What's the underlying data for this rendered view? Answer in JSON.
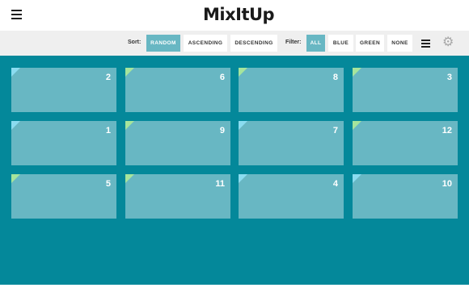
{
  "header": {
    "logo_text": "MixItUp",
    "menu_icon": "hamburger-menu-icon"
  },
  "controls": {
    "sort_label": "Sort:",
    "sort_options": [
      "RANDOM",
      "ASCENDING",
      "DESCENDING"
    ],
    "sort_selected": "RANDOM",
    "filter_label": "Filter:",
    "filter_options": [
      "ALL",
      "BLUE",
      "GREEN",
      "NONE"
    ],
    "filter_selected": "ALL",
    "layout_icon": "list-layout-icon",
    "settings_icon": "gear-icon"
  },
  "colors": {
    "grid_background": "#04889a",
    "card_background": "#68b7c3",
    "active_button": "#68b7c3",
    "blue_marker": "#8bdcf0",
    "green_marker": "#a6e59c"
  },
  "cards": [
    {
      "number": "2",
      "color": "blue"
    },
    {
      "number": "6",
      "color": "green"
    },
    {
      "number": "8",
      "color": "green"
    },
    {
      "number": "3",
      "color": "green"
    },
    {
      "number": "1",
      "color": "blue"
    },
    {
      "number": "9",
      "color": "green"
    },
    {
      "number": "7",
      "color": "blue"
    },
    {
      "number": "12",
      "color": "green"
    },
    {
      "number": "5",
      "color": "green"
    },
    {
      "number": "11",
      "color": "green"
    },
    {
      "number": "4",
      "color": "blue"
    },
    {
      "number": "10",
      "color": "blue"
    }
  ]
}
